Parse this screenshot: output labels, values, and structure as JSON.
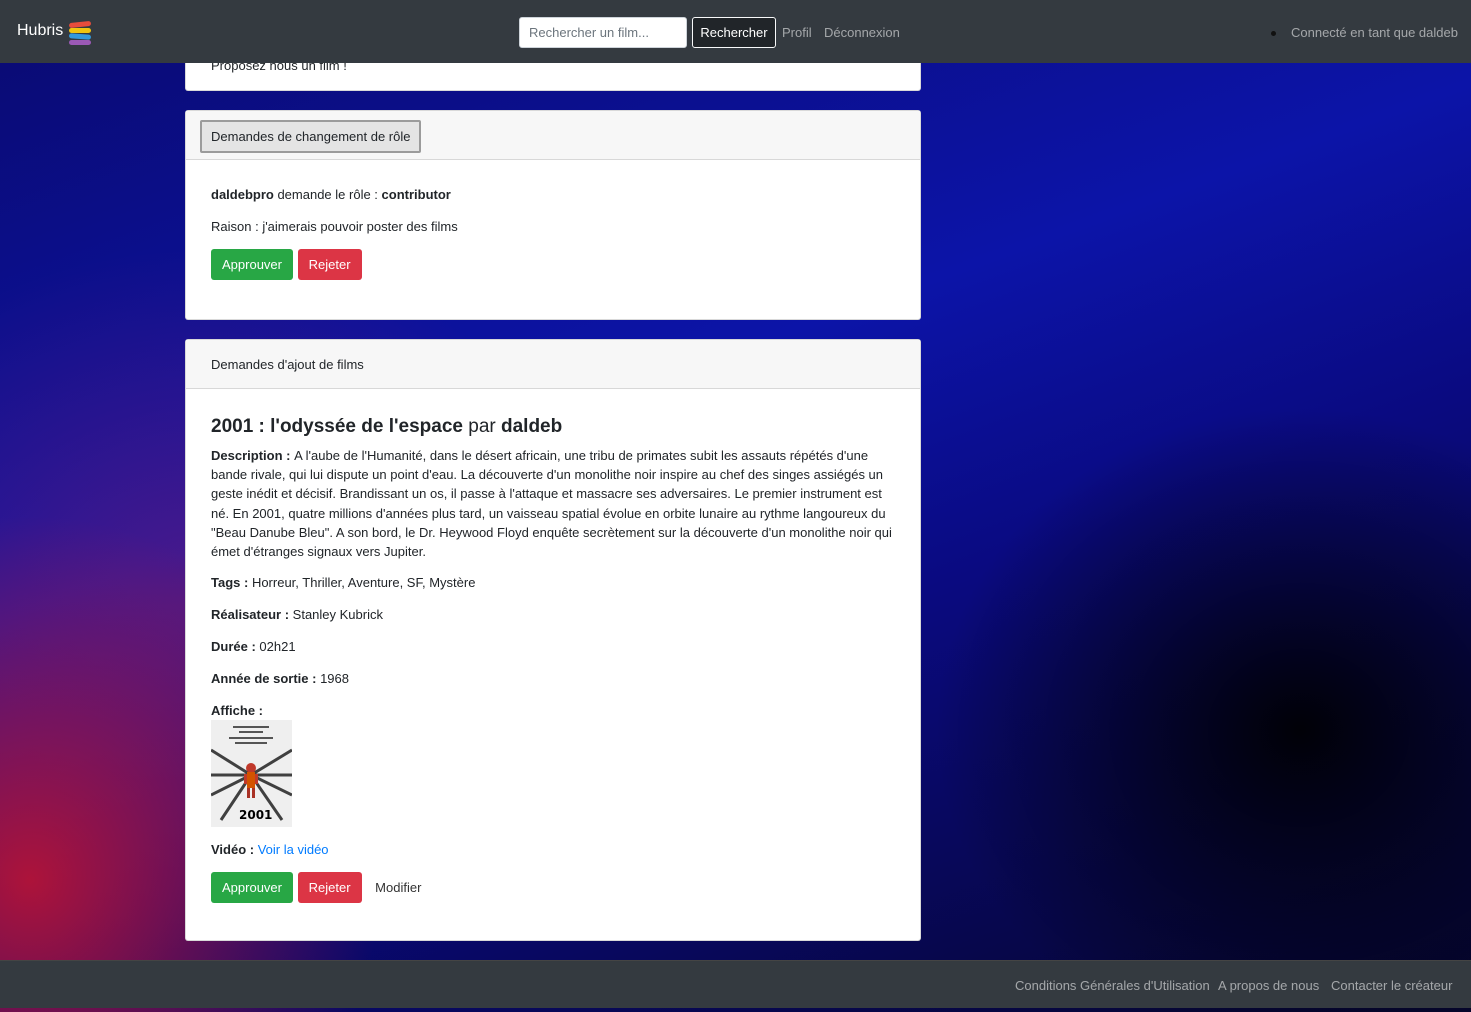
{
  "navbar": {
    "brand": "Hubris",
    "logo_colors": [
      "#e74c3c",
      "#f1c40f",
      "#3498db",
      "#9b59b6"
    ],
    "search_placeholder": "Rechercher un film...",
    "search_button": "Rechercher",
    "profile_link": "Profil",
    "logout_link": "Déconnexion",
    "connected_as": "Connecté en tant que daldeb"
  },
  "propose_card": {
    "text": "Proposez nous un film !"
  },
  "role_requests": {
    "header": "Demandes de changement de rôle",
    "username": "daldebpro",
    "requests_text": " demande le rôle : ",
    "role": "contributor",
    "reason_label": "Raison : ",
    "reason": "j'aimerais pouvoir poster des films",
    "approve_label": "Approuver",
    "reject_label": "Rejeter"
  },
  "film_requests": {
    "header": "Demandes d'ajout de films",
    "film": {
      "title": "2001 : l'odyssée de l'espace",
      "by": " par ",
      "author": "daldeb",
      "description_label": "Description : ",
      "description": "A l'aube de l'Humanité, dans le désert africain, une tribu de primates subit les assauts répétés d'une bande rivale, qui lui dispute un point d'eau. La découverte d'un monolithe noir inspire au chef des singes assiégés un geste inédit et décisif. Brandissant un os, il passe à l'attaque et massacre ses adversaires. Le premier instrument est né. En 2001, quatre millions d'années plus tard, un vaisseau spatial évolue en orbite lunaire au rythme langoureux du \"Beau Danube Bleu\". A son bord, le Dr. Heywood Floyd enquête secrètement sur la découverte d'un monolithe noir qui émet d'étranges signaux vers Jupiter.",
      "tags_label": "Tags : ",
      "tags": "Horreur, Thriller, Aventure, SF, Mystère",
      "director_label": "Réalisateur : ",
      "director": "Stanley Kubrick",
      "duration_label": "Durée : ",
      "duration": "02h21",
      "year_label": "Année de sortie : ",
      "year": "1968",
      "poster_label": "Affiche :",
      "poster_text": "2001",
      "video_label": "Vidéo : ",
      "video_link": "Voir la vidéo",
      "approve_label": "Approuver",
      "reject_label": "Rejeter",
      "modify_label": "Modifier"
    }
  },
  "footer": {
    "terms": "Conditions Générales d'Utilisation",
    "about": "A propos de nous",
    "contact": "Contacter le créateur"
  }
}
